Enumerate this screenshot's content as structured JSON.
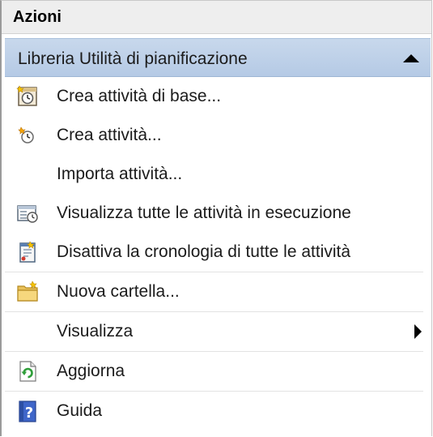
{
  "panel": {
    "title": "Azioni"
  },
  "section": {
    "label": "Libreria Utilità di pianificazione"
  },
  "items": [
    {
      "label": "Crea attività di base...",
      "icon": "task-wizard-icon"
    },
    {
      "label": "Crea attività...",
      "icon": "create-task-icon"
    },
    {
      "label": "Importa attività...",
      "icon": ""
    },
    {
      "label": "Visualizza tutte le attività in esecuzione",
      "icon": "running-tasks-icon"
    },
    {
      "label": "Disattiva la cronologia di tutte le attività",
      "icon": "history-icon"
    },
    {
      "label": "Nuova cartella...",
      "icon": "folder-icon"
    },
    {
      "label": "Visualizza",
      "icon": ""
    },
    {
      "label": "Aggiorna",
      "icon": "refresh-icon"
    },
    {
      "label": "Guida",
      "icon": "help-icon"
    }
  ]
}
